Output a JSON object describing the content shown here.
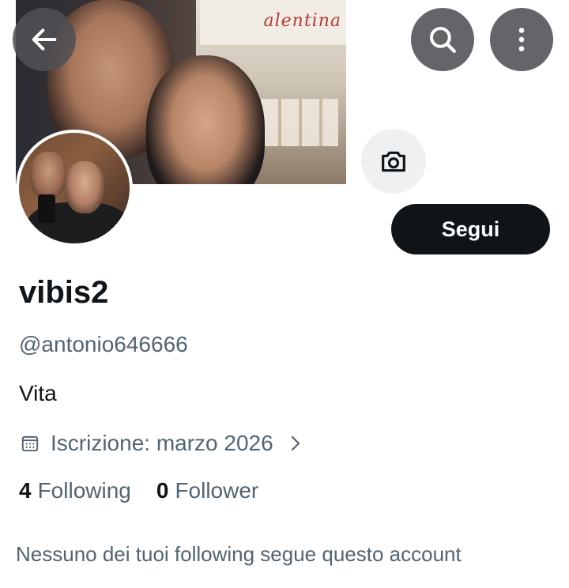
{
  "header": {
    "back_icon": "arrow-left-icon",
    "search_icon": "search-icon",
    "more_icon": "more-vertical-icon",
    "shop_sign": "alentina"
  },
  "banner": {
    "edit_icon": "camera-icon"
  },
  "profile": {
    "display_name": "vibis2",
    "handle": "@antonio646666",
    "bio": "Vita",
    "joined": "Iscrizione: marzo 2026",
    "follow_label": "Segui"
  },
  "stats": {
    "following_count": "4",
    "following_label": "Following",
    "follower_count": "0",
    "follower_label": "Follower"
  },
  "mutuals_note": "Nessuno dei tuoi following segue questo account",
  "colors": {
    "primary_text": "#0f1419",
    "secondary_text": "#536471",
    "button_bg": "#0f1419",
    "overlay_button": "#505054"
  }
}
